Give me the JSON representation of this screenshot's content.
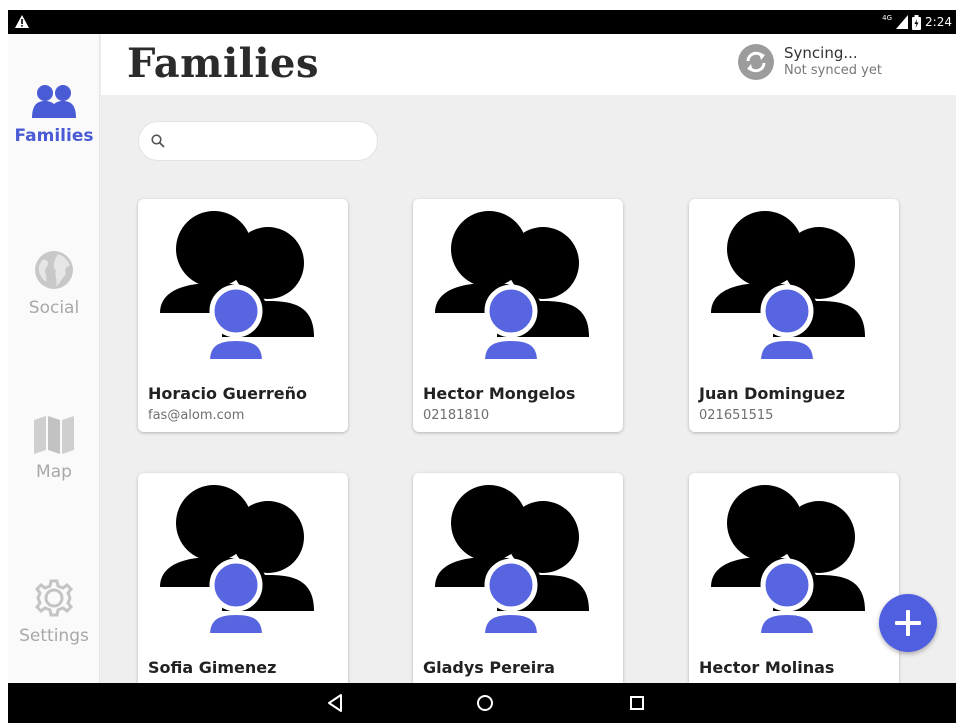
{
  "status_bar": {
    "network": "4G",
    "time": "2:24",
    "warning_icon": "warning-icon",
    "signal_icon": "signal-icon",
    "battery_icon": "battery-icon"
  },
  "sidebar": {
    "items": [
      {
        "label": "Families",
        "icon": "families-icon",
        "active": true
      },
      {
        "label": "Social",
        "icon": "globe-icon",
        "active": false
      },
      {
        "label": "Map",
        "icon": "map-icon",
        "active": false
      },
      {
        "label": "Settings",
        "icon": "gear-icon",
        "active": false
      }
    ]
  },
  "header": {
    "title": "Families",
    "sync": {
      "title": "Syncing...",
      "subtitle": "Not synced yet",
      "icon": "sync-icon"
    }
  },
  "search": {
    "placeholder": "",
    "value": "",
    "icon": "search-icon"
  },
  "families": [
    {
      "name": "Horacio Guerreño",
      "detail": "fas@alom.com"
    },
    {
      "name": "Hector Mongelos",
      "detail": "02181810"
    },
    {
      "name": "Juan Dominguez",
      "detail": "021651515"
    },
    {
      "name": "Sofia Gimenez",
      "detail": ""
    },
    {
      "name": "Gladys Pereira",
      "detail": ""
    },
    {
      "name": "Hector Molinas",
      "detail": ""
    }
  ],
  "fab": {
    "icon": "plus-icon"
  },
  "nav_bar": {
    "back_icon": "back-icon",
    "home_icon": "home-icon",
    "recents_icon": "recents-icon"
  },
  "colors": {
    "accent": "#4f5fe0",
    "active_label": "#4a5bd6",
    "inactive": "#a8a8a8"
  }
}
